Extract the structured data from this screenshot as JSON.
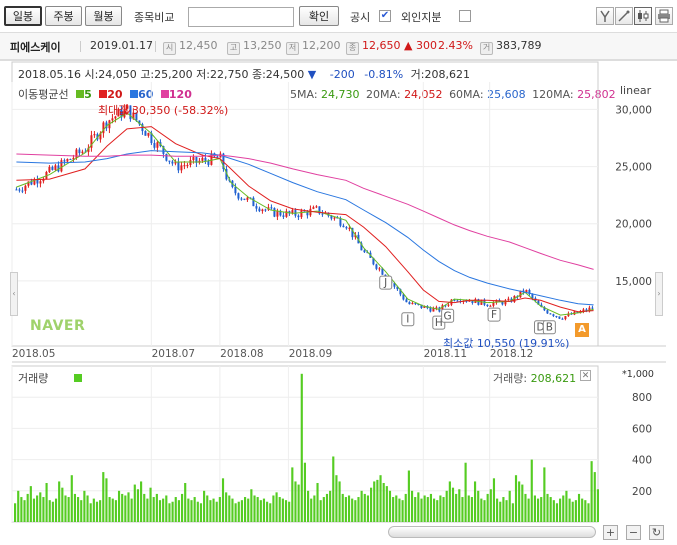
{
  "toolbar": {
    "daily": "일봉",
    "weekly": "주봉",
    "monthly": "월봉",
    "compare_label": "종목비교",
    "compare_input": "",
    "confirm": "확인",
    "disclosure": "공시",
    "disclosure_checked": "✔",
    "foreign": "외인지분",
    "foreign_checked": ""
  },
  "stock": {
    "name": "피에스케이",
    "date": "2019.01.17",
    "open_tag": "시",
    "open": "12,450",
    "high_tag": "고",
    "high": "13,250",
    "low_tag": "저",
    "low": "12,200",
    "close_tag": "종",
    "close": "12,650",
    "change_arrow": "▲",
    "change": "300",
    "change_pct": "2.43%",
    "volume_tag": "거",
    "volume": "383,789"
  },
  "hover": {
    "date": "2018.05.16",
    "open": "시:24,050",
    "high": "고:25,200",
    "low": "저:22,750",
    "close": "종:24,500",
    "arrow": "▼",
    "change": "-200",
    "change_pct": "-0.81%",
    "volume": "거:208,621"
  },
  "legend": {
    "title": "이동평균선",
    "ma5": "5",
    "ma20": "20",
    "ma60": "60",
    "ma120": "120",
    "ma5_label": "5MA:",
    "ma5_value": "24,730",
    "ma20_label": "20MA:",
    "ma20_value": "24,052",
    "ma60_label": "60MA:",
    "ma60_value": "25,608",
    "ma120_label": "120MA:",
    "ma120_value": "25,802",
    "scale": "linear"
  },
  "annotations": {
    "max_label": "최대값 30,350 (-58.32%)",
    "min_label": "최소값 10,550 (19.91%)",
    "logo": "NAVER",
    "flag_a": "A"
  },
  "volume_panel": {
    "title": "거래량",
    "current_label": "거래량:",
    "current_value": "208,621",
    "unit": "*1,000"
  },
  "colors": {
    "up": "#e02020",
    "down": "#2060d0",
    "ma5": "#66bb22",
    "ma20": "#e02020",
    "ma60": "#2a77e0",
    "ma120": "#e040a0",
    "volume": "#55cc22"
  },
  "chart_data": {
    "type": "line",
    "title": "피에스케이",
    "x_ticks": [
      "2018.05",
      "2018.07",
      "2018.08",
      "2018.09",
      "2018.11",
      "2018.12"
    ],
    "y_ticks": [
      "15,000",
      "20,000",
      "25,000",
      "30,000"
    ],
    "ylim": [
      9300,
      32400
    ],
    "price_x": [
      "2018.05.01",
      "2018.05.16",
      "2018.06.01",
      "2018.06.11",
      "2018.06.20",
      "2018.07.01",
      "2018.07.12",
      "2018.07.24",
      "2018.08.01",
      "2018.08.06",
      "2018.08.14",
      "2018.08.24",
      "2018.09.03",
      "2018.09.14",
      "2018.09.27",
      "2018.10.05",
      "2018.10.15",
      "2018.10.25",
      "2018.11.01",
      "2018.11.08",
      "2018.11.15",
      "2018.11.22",
      "2018.11.30",
      "2018.12.10",
      "2018.12.17",
      "2018.12.24",
      "2019.01.02",
      "2019.01.10",
      "2019.01.17"
    ],
    "series": [
      {
        "name": "close",
        "values": [
          23000,
          24500,
          26500,
          29000,
          30000,
          27500,
          25000,
          25500,
          25800,
          23000,
          22000,
          21000,
          20800,
          21200,
          20000,
          17500,
          15500,
          13000,
          12700,
          12400,
          13500,
          13300,
          13000,
          13200,
          14200,
          12600,
          11800,
          12200,
          12650
        ]
      },
      {
        "name": "5",
        "values": [
          23200,
          24300,
          26200,
          28600,
          29700,
          27900,
          25400,
          25400,
          25700,
          23600,
          22300,
          21200,
          20900,
          21100,
          20300,
          17900,
          15800,
          13400,
          12800,
          12500,
          13400,
          13300,
          13100,
          13200,
          14000,
          12800,
          12000,
          12200,
          12500
        ]
      },
      {
        "name": "20",
        "values": [
          23800,
          23900,
          24800,
          26800,
          28300,
          28500,
          27000,
          26000,
          25700,
          24800,
          23300,
          22000,
          21300,
          21000,
          20800,
          19700,
          18000,
          15800,
          14200,
          13200,
          13100,
          13300,
          13300,
          13200,
          13500,
          13300,
          12700,
          12300,
          12400
        ]
      },
      {
        "name": "60",
        "values": [
          25400,
          25300,
          25400,
          25700,
          26100,
          26400,
          26300,
          26200,
          26000,
          25700,
          25200,
          24400,
          23600,
          22800,
          22100,
          21200,
          20100,
          18800,
          17700,
          16700,
          15900,
          15300,
          14800,
          14300,
          14000,
          13700,
          13300,
          13000,
          12900
        ]
      },
      {
        "name": "120",
        "values": [
          26100,
          26000,
          25900,
          25900,
          26000,
          26000,
          25900,
          25900,
          26000,
          25900,
          25700,
          25300,
          24800,
          24300,
          23800,
          23100,
          22400,
          21700,
          21100,
          20500,
          19900,
          19400,
          18900,
          18400,
          17900,
          17400,
          16800,
          16400,
          16000
        ]
      }
    ],
    "volume": {
      "ylabel": "거래량",
      "ylim": [
        0,
        1000
      ],
      "y_ticks": [
        "200",
        "400",
        "600",
        "800"
      ],
      "values": [
        120,
        200,
        160,
        140,
        180,
        230,
        150,
        170,
        190,
        160,
        250,
        140,
        130,
        150,
        260,
        220,
        170,
        160,
        300,
        180,
        160,
        140,
        200,
        170,
        120,
        150,
        130,
        140,
        320,
        280,
        160,
        150,
        140,
        200,
        180,
        170,
        190,
        150,
        240,
        210,
        260,
        180,
        150,
        220,
        160,
        180,
        140,
        150,
        170,
        120,
        130,
        160,
        140,
        180,
        250,
        150,
        140,
        160,
        130,
        120,
        200,
        170,
        140,
        150,
        130,
        160,
        280,
        190,
        170,
        150,
        120,
        130,
        140,
        160,
        150,
        210,
        170,
        160,
        140,
        150,
        130,
        120,
        170,
        190,
        160,
        150,
        140,
        130,
        350,
        260,
        240,
        950,
        380,
        200,
        150,
        170,
        250,
        140,
        160,
        180,
        200,
        420,
        300,
        260,
        180,
        160,
        170,
        150,
        140,
        160,
        200,
        180,
        170,
        220,
        260,
        270,
        300,
        250,
        230,
        200,
        160,
        170,
        150,
        140,
        180,
        330,
        200,
        160,
        190,
        150,
        170,
        160,
        180,
        150,
        140,
        170,
        160,
        200,
        260,
        220,
        180,
        210,
        160,
        380,
        170,
        160,
        260,
        200,
        150,
        140,
        180,
        210,
        280,
        150,
        130,
        160,
        140,
        200,
        120,
        300,
        260,
        240,
        180,
        150,
        400,
        170,
        150,
        160,
        350,
        180,
        160,
        140,
        120,
        150,
        170,
        200,
        150,
        130,
        140,
        180,
        150,
        140,
        120,
        390,
        320,
        210
      ]
    }
  }
}
